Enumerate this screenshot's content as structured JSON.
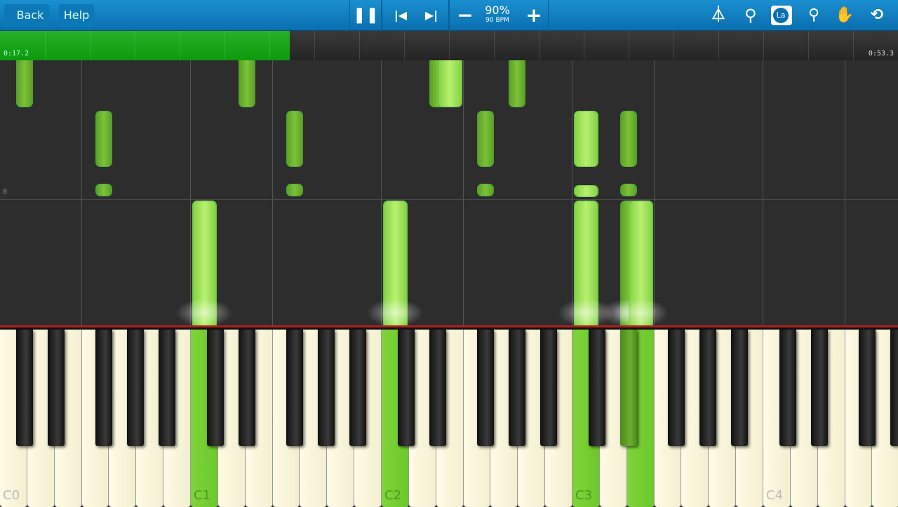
{
  "toolbar": {
    "back_label": "Back",
    "help_label": "Help",
    "speed_percent": "90%",
    "speed_bpm": "90 BPM",
    "icons": [
      "pause-icon",
      "skip-back-icon",
      "skip-forward-icon",
      "minus-icon",
      "plus-icon",
      "metronome-icon",
      "magnifier-icon",
      "note-labels-icon",
      "marker-icon",
      "hand-icon",
      "loop-icon"
    ],
    "note_label_badge": "La"
  },
  "progress": {
    "current_time": "0:17.2",
    "total_time": "0:53.3",
    "fraction": 0.323
  },
  "roll": {
    "measure_label": "8",
    "accent": "#7cc23a",
    "notes": [
      {
        "key": "C#0",
        "start": 3.09,
        "dur": 0.9
      },
      {
        "key": "F#0",
        "start": 2.24,
        "dur": 0.8
      },
      {
        "key": "F#0",
        "start": 1.82,
        "dur": 0.18
      },
      {
        "key": "C1",
        "start": 0,
        "dur": 1.76
      },
      {
        "key": "D#1",
        "start": 3.09,
        "dur": 0.9
      },
      {
        "key": "F#1",
        "start": 2.24,
        "dur": 0.8
      },
      {
        "key": "F#1",
        "start": 1.82,
        "dur": 0.18
      },
      {
        "key": "C2",
        "start": 0,
        "dur": 1.76
      },
      {
        "key": "D#2",
        "start": 3.09,
        "dur": 0.9
      },
      {
        "key": "E2",
        "start": 3.09,
        "dur": 0.9
      },
      {
        "key": "F#2",
        "start": 2.24,
        "dur": 0.8
      },
      {
        "key": "F#2",
        "start": 1.82,
        "dur": 0.18
      },
      {
        "key": "G#2",
        "start": 3.09,
        "dur": 0.9
      },
      {
        "key": "C3",
        "start": 2.24,
        "dur": 0.8
      },
      {
        "key": "C3",
        "start": 1.81,
        "dur": 0.17
      },
      {
        "key": "C3",
        "start": 0,
        "dur": 1.76
      },
      {
        "key": "D#3",
        "start": 2.24,
        "dur": 0.8
      },
      {
        "key": "D#3",
        "start": 1.82,
        "dur": 0.18
      },
      {
        "key": "D#3",
        "start": 0,
        "dur": 1.76
      },
      {
        "key": "E3",
        "start": 0,
        "dur": 1.76
      }
    ]
  },
  "keyboard": {
    "octave_labels": [
      "C0",
      "C1",
      "C2",
      "C3",
      "C4"
    ],
    "pressed": [
      "C1",
      "C2",
      "C3",
      "D#3",
      "E3"
    ]
  }
}
